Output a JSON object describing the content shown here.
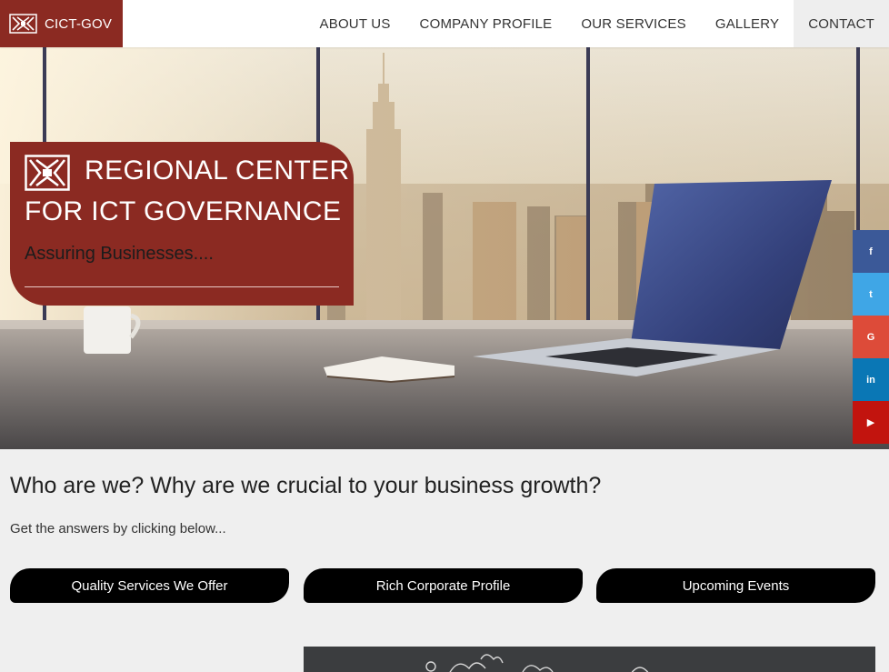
{
  "header": {
    "brand": "CICT-GOV",
    "nav": [
      {
        "label": "ABOUT US"
      },
      {
        "label": "COMPANY PROFILE"
      },
      {
        "label": "OUR SERVICES"
      },
      {
        "label": "GALLERY"
      },
      {
        "label": "CONTACT"
      }
    ]
  },
  "hero": {
    "title_line1": "REGIONAL CENTER",
    "title_line2": "FOR ICT GOVERNANCE",
    "tagline": "Assuring Businesses...."
  },
  "social": [
    {
      "icon": "facebook-icon",
      "glyph": "f"
    },
    {
      "icon": "twitter-icon",
      "glyph": "t"
    },
    {
      "icon": "google-plus-icon",
      "glyph": "G"
    },
    {
      "icon": "linkedin-icon",
      "glyph": "in"
    },
    {
      "icon": "youtube-icon",
      "glyph": "▶"
    }
  ],
  "content": {
    "headline": "Who are we? Why are we crucial to your business growth?",
    "subline": "Get the answers by clicking below...",
    "buttons": [
      {
        "label": "Quality Services We Offer"
      },
      {
        "label": "Rich Corporate Profile"
      },
      {
        "label": "Upcoming Events"
      }
    ]
  },
  "colors": {
    "brand": "#8b2a22",
    "button": "#000000",
    "background": "#efefef"
  }
}
